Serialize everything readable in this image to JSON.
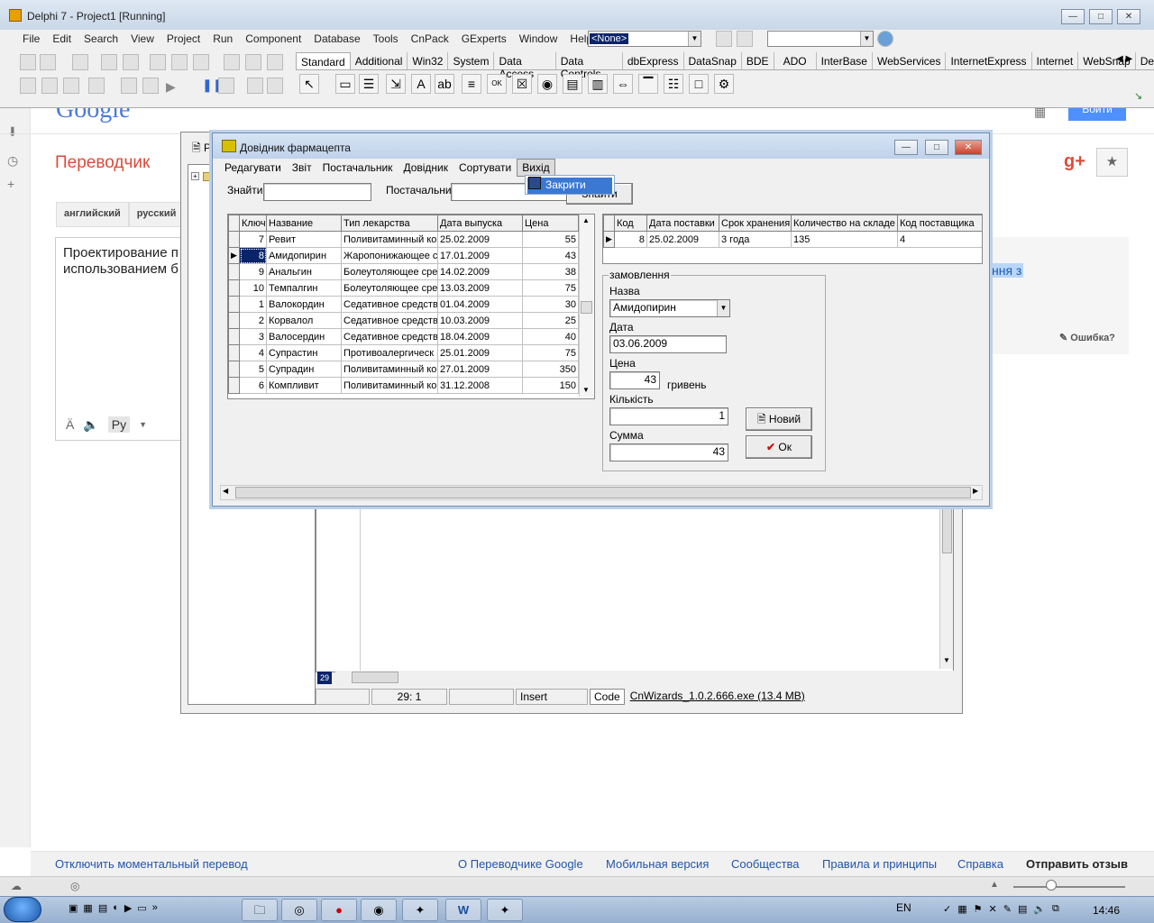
{
  "google": {
    "logo_text": "Google",
    "login_button": "Войти",
    "page_title": "Переводчик",
    "lang_tabs": [
      "английский",
      "русский"
    ],
    "source_text": "Проектирование п средствами объе использованием б",
    "result_highlight": "ння з",
    "error_link": "Ошибка?",
    "ru_button": "Ру",
    "footer": {
      "toggle_instant": "Отключить моментальный перевод",
      "about": "О Переводчике Google",
      "mobile": "Мобильная версия",
      "communities": "Сообщества",
      "policies": "Правила и принципы",
      "help": "Справка",
      "feedback": "Отправить отзыв"
    }
  },
  "ide": {
    "title": "Delphi 7 - Project1 [Running]",
    "menu": [
      "File",
      "Edit",
      "Search",
      "View",
      "Project",
      "Run",
      "Component",
      "Database",
      "Tools",
      "CnPack",
      "GExperts",
      "Window",
      "Help"
    ],
    "combo_value": "<None>",
    "palette_tabs": [
      "Standard",
      "Additional",
      "Win32",
      "System",
      "Data Access",
      "Data Controls",
      "dbExpress",
      "DataSnap",
      "BDE",
      "ADO",
      "InterBase",
      "WebServices",
      "InternetExpress",
      "Internet",
      "WebSnap",
      "De"
    ],
    "editor_status": {
      "position": "29:  1",
      "mode": "Insert",
      "tab": "Code",
      "cnwizards": "CnWizards_1.0.2.666.exe (13.4 MB)"
    }
  },
  "app": {
    "title": "Довідник фармацепта",
    "menu": [
      "Редагувати",
      "Звіт",
      "Постачальник",
      "Довідник",
      "Сортувати",
      "Вихід"
    ],
    "dropdown_item": "Закрити",
    "find_label": "Знайти",
    "supplier_label": "Постачальник",
    "find_button": "Знайти",
    "grid1": {
      "columns": [
        "Ключ",
        "Название",
        "Тип лекарства",
        "Дата выпуска",
        "Цена"
      ],
      "rows": [
        [
          "7",
          "Ревит",
          "Поливитаминный ко",
          "25.02.2009",
          "55"
        ],
        [
          "8",
          "Амидопирин",
          "Жаропонижающее с",
          "17.01.2009",
          "43"
        ],
        [
          "9",
          "Анальгин",
          "Болеутоляющее сре",
          "14.02.2009",
          "38"
        ],
        [
          "10",
          "Темпалгин",
          "Болеутоляющее сре",
          "13.03.2009",
          "75"
        ],
        [
          "1",
          "Валокордин",
          "Седативное средств",
          "01.04.2009",
          "30"
        ],
        [
          "2",
          "Корвалол",
          "Седативное средств",
          "10.03.2009",
          "25"
        ],
        [
          "3",
          "Валосердин",
          "Седативное средств",
          "18.04.2009",
          "40"
        ],
        [
          "4",
          "Супрастин",
          "Противоалергическ",
          "25.01.2009",
          "75"
        ],
        [
          "5",
          "Супрадин",
          "Поливитаминный ко",
          "27.01.2009",
          "350"
        ],
        [
          "6",
          "Компливит",
          "Поливитаминный ко",
          "31.12.2008",
          "150"
        ]
      ]
    },
    "grid2": {
      "columns": [
        "Код",
        "Дата поставки",
        "Срок хранения",
        "Количество на складе",
        "Код поставщика"
      ],
      "rows": [
        [
          "8",
          "25.02.2009",
          "3 года",
          "135",
          "4"
        ]
      ]
    },
    "order": {
      "group_title": "замовлення",
      "name_label": "Назва",
      "name_value": "Амидопирин",
      "date_label": "Дата",
      "date_value": "03.06.2009",
      "price_label": "Цена",
      "price_value": "43",
      "currency": "гривень",
      "qty_label": "Кількість",
      "qty_value": "1",
      "sum_label": "Сумма",
      "sum_value": "43",
      "new_button": "Новий",
      "ok_button": "Ок"
    }
  },
  "editor_hint": "29",
  "taskbar": {
    "language": "EN",
    "clock": "14:46"
  }
}
